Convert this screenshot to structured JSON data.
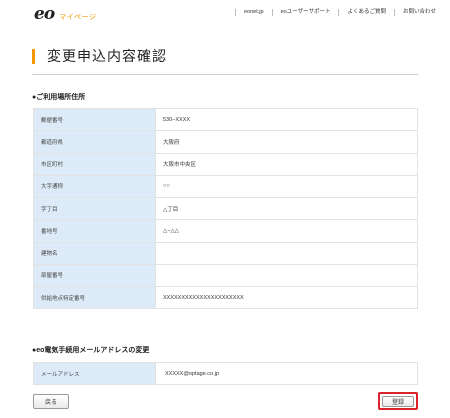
{
  "header": {
    "logo_mark": "eo",
    "logo_text": "マイページ",
    "nav": [
      "eonet.jp",
      "eoユーザーサポート",
      "よくあるご質問",
      "お問い合わせ"
    ]
  },
  "page": {
    "title": "変更申込内容確認"
  },
  "address_section": {
    "heading": "●ご利用場所住所",
    "rows": [
      {
        "label": "郵便番号",
        "value": "530−XXXX"
      },
      {
        "label": "都道府県",
        "value": "大阪府"
      },
      {
        "label": "市区町村",
        "value": "大阪市中央区"
      },
      {
        "label": "大字通称",
        "value": "○○"
      },
      {
        "label": "字丁目",
        "value": "△丁目"
      },
      {
        "label": "番地号",
        "value": "△−△△"
      },
      {
        "label": "建物名",
        "value": ""
      },
      {
        "label": "部屋番号",
        "value": ""
      },
      {
        "label": "供給地点特定番号",
        "value": "XXXXXXXXXXXXXXXXXXXXXX"
      }
    ]
  },
  "mail_section": {
    "heading": "●eo電気手続用メールアドレスの変更",
    "rows": [
      {
        "label": "メールアドレス",
        "value": "XXXXX@optage.co.jp"
      }
    ]
  },
  "buttons": {
    "back": "戻る",
    "submit": "登録"
  },
  "colors": {
    "accent": "#f39800",
    "label_bg": "#ddeaf7",
    "highlight": "#d9232d"
  }
}
